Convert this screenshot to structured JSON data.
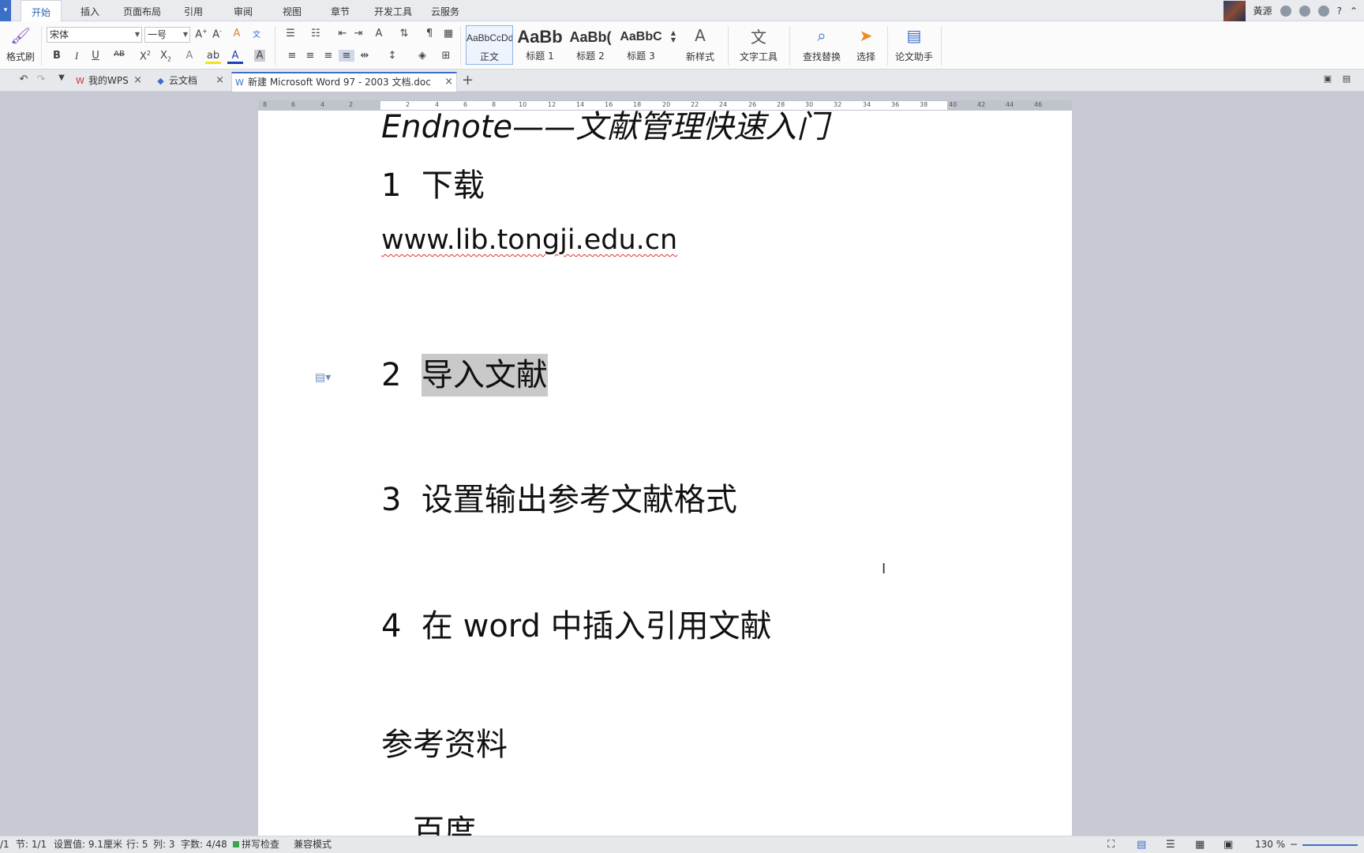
{
  "menu": {
    "app_arrow": "▾",
    "tabs": [
      "开始",
      "插入",
      "页面布局",
      "引用",
      "审阅",
      "视图",
      "章节",
      "开发工具",
      "云服务"
    ],
    "active_tab": "开始"
  },
  "user": {
    "name": "黃源"
  },
  "ribbon": {
    "format_painter": "格式刷",
    "font_name": "宋体",
    "font_size": "一号",
    "styles": [
      {
        "preview": "AaBbCcDd",
        "name": "正文"
      },
      {
        "preview": "AaBb",
        "name": "标题 1"
      },
      {
        "preview": "AaBb(",
        "name": "标题 2"
      },
      {
        "preview": "AaBbC",
        "name": "标题 3"
      }
    ],
    "new_style": "新样式",
    "text_tools": "文字工具",
    "find_replace": "查找替换",
    "select": "选择",
    "thesis_helper": "论文助手"
  },
  "tabs": [
    {
      "label": "我的WPS",
      "icon": "wps-icon"
    },
    {
      "label": "云文档",
      "icon": "cloud-doc-icon"
    },
    {
      "label": "新建 Microsoft Word 97 - 2003 文档.doc",
      "icon": "word-doc-icon"
    }
  ],
  "ruler": {
    "ticks": [
      "8",
      "6",
      "4",
      "2",
      "2",
      "4",
      "6",
      "8",
      "10",
      "12",
      "14",
      "16",
      "18",
      "20",
      "22",
      "24",
      "26",
      "28",
      "30",
      "32",
      "34",
      "36",
      "38",
      "40",
      "42",
      "44",
      "46"
    ]
  },
  "document": {
    "title_partial": "Endnote——文献管理快速入门",
    "s1_num": "1",
    "s1_text": "下载",
    "url": "www.lib.tongji.edu.cn",
    "s2_num": "2",
    "s2_text": "导入文献",
    "s3_num": "3",
    "s3_text": "设置输出参考文献格式",
    "s4_num": "4",
    "s4_text": "在 word 中插入引用文献",
    "ref_heading": "参考资料",
    "ref_item": "百度"
  },
  "status": {
    "page": "/1",
    "section": "节: 1/1",
    "setting": "设置值: 9.1厘米",
    "row": "行: 5",
    "col": "列: 3",
    "words": "字数: 4/48",
    "spell": "拼写检查",
    "compat": "兼容模式",
    "zoom": "130 %"
  }
}
